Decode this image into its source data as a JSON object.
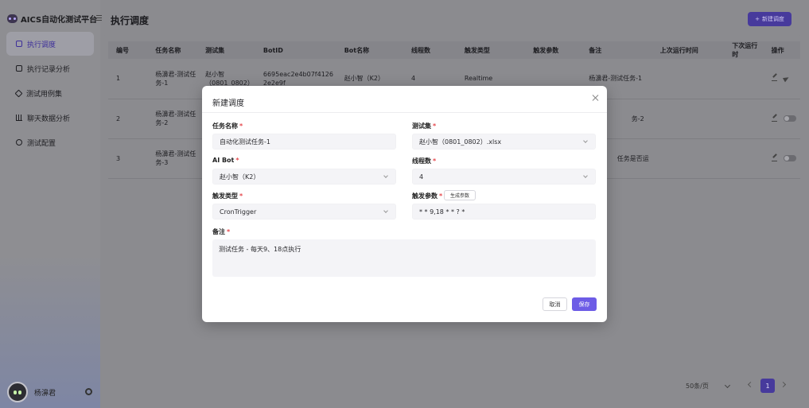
{
  "app": {
    "title": "AICS自动化测试平台"
  },
  "sidebar": {
    "items": [
      {
        "label": "执行调度",
        "icon": "schedule-icon",
        "active": true
      },
      {
        "label": "执行记录分析",
        "icon": "chat-record-icon",
        "active": false
      },
      {
        "label": "测试用例集",
        "icon": "diamond-icon",
        "active": false
      },
      {
        "label": "聊天数据分析",
        "icon": "bar-chart-icon",
        "active": false
      },
      {
        "label": "测试配置",
        "icon": "gear-icon",
        "active": false
      }
    ],
    "user": {
      "name": "杨濞君"
    }
  },
  "page": {
    "title": "执行调度",
    "new_button": "新建调度"
  },
  "table": {
    "headers": [
      "编号",
      "任务名称",
      "测试集",
      "BotID",
      "Bot名称",
      "线程数",
      "触发类型",
      "触发参数",
      "备注",
      "上次运行时间",
      "下次运行时",
      "操作"
    ],
    "rows": [
      {
        "id": "1",
        "name": "杨濞君-测试任务-1",
        "set": "赵小智（0801_0802）",
        "bot_id": "6695eac2e4b07f41262e2e9f",
        "bot_name": "赵小智（K2）",
        "threads": "4",
        "trigger": "Realtime",
        "params": "",
        "note": "杨濞君-测试任务-1",
        "last": "",
        "next": ""
      },
      {
        "id": "2",
        "name": "杨濞君-测试任务-2",
        "set": "",
        "bot_id": "",
        "bot_name": "",
        "threads": "",
        "trigger": "",
        "params": "",
        "note": "务-2",
        "last": "",
        "next": ""
      },
      {
        "id": "3",
        "name": "杨濞君-测试任务-3",
        "set": "",
        "bot_id": "",
        "bot_name": "",
        "threads": "",
        "trigger": "",
        "params": "",
        "note": "任务是否运",
        "last": "",
        "next": ""
      }
    ]
  },
  "pager": {
    "page_size": "50条/页",
    "current": "1"
  },
  "modal": {
    "title": "新建调度",
    "task_name": {
      "label": "任务名称",
      "value": "自动化测试任务-1"
    },
    "test_set": {
      "label": "测试集",
      "value": "赵小智（0801_0802）.xlsx"
    },
    "ai_bot": {
      "label": "AI Bot",
      "value": "赵小智（K2）"
    },
    "threads": {
      "label": "线程数",
      "value": "4"
    },
    "trigger_type": {
      "label": "触发类型",
      "value": "CronTrigger"
    },
    "trigger_params": {
      "label": "触发参数",
      "value": "* * 9,18 * * ? *",
      "gen_button": "生成参数"
    },
    "note": {
      "label": "备注",
      "value": "测试任务 - 每天9、18点执行"
    },
    "cancel": "取消",
    "save": "保存",
    "required_mark": "*"
  },
  "colors": {
    "accent": "#6d5ce6",
    "required": "#e5484d"
  }
}
